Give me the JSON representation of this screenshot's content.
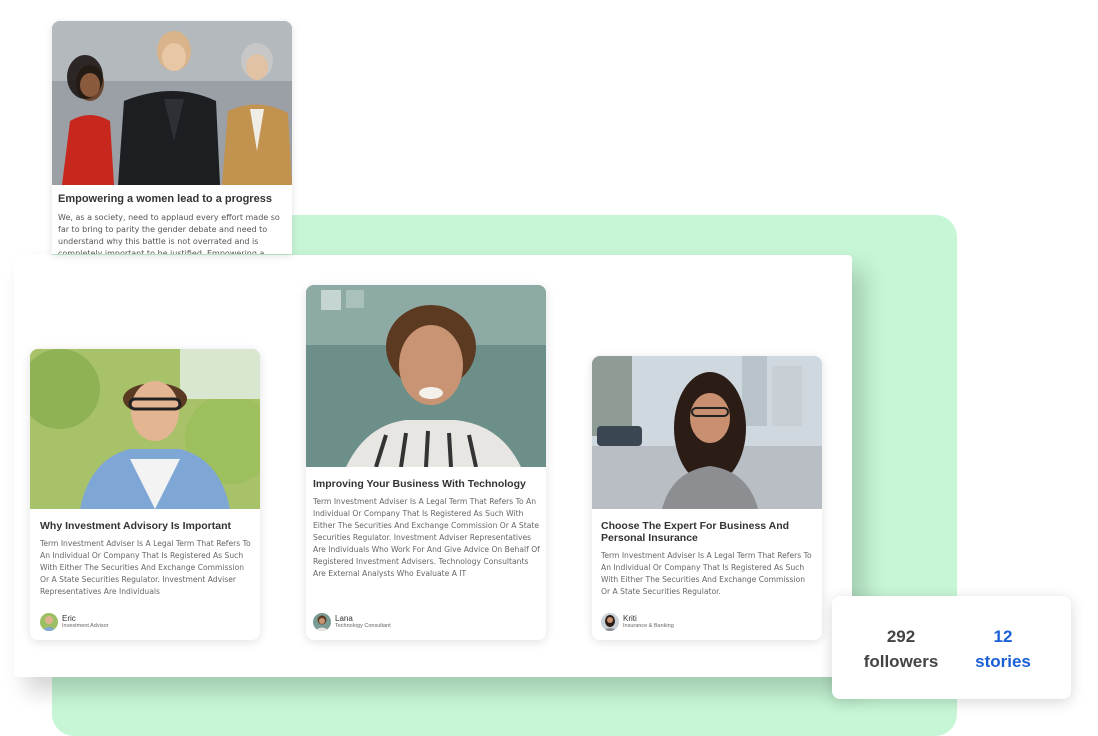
{
  "cards": {
    "top": {
      "title": "Empowering a women lead to a progress",
      "body": "We, as a society, need to applaud every effort made so far to bring to parity the gender debate and need to understand why this battle is not overrated and is completely important to be justified. Empowering a"
    },
    "eric": {
      "title": "Why Investment Advisory Is Important",
      "body": "Term Investment Adviser Is A Legal Term That Refers To An Individual Or Company That Is Registered As Such With Either The Securities And Exchange Commission Or A State Securities Regulator. Investment Adviser Representatives Are Individuals",
      "author_name": "Eric",
      "author_role": "Investment Advisor"
    },
    "lana": {
      "title": "Improving Your Business With Technology",
      "body": "Term Investment Adviser Is A Legal Term That Refers To An Individual Or Company That Is Registered As Such With Either The Securities And Exchange Commission Or A State Securities Regulator. Investment Adviser Representatives Are Individuals Who Work For And Give Advice On Behalf Of Registered Investment Advisers. Technology Consultants Are External Analysts Who Evaluate A IT",
      "author_name": "Lana",
      "author_role": "Technology Consultant"
    },
    "kriti": {
      "title": "Choose The Expert For Business And Personal Insurance",
      "body": "Term Investment Adviser Is A Legal Term That Refers To An Individual Or Company That Is Registered As Such With Either The Securities And Exchange Commission Or A State Securities Regulator.",
      "author_name": "Kriti",
      "author_role": "Insurance & Banking"
    }
  },
  "stats": {
    "followers_count": "292",
    "followers_label": "followers",
    "stories_count": "12",
    "stories_label": "stories"
  },
  "colors": {
    "accent_green": "#c6f6d5",
    "stories_blue": "#1a5fd6"
  }
}
